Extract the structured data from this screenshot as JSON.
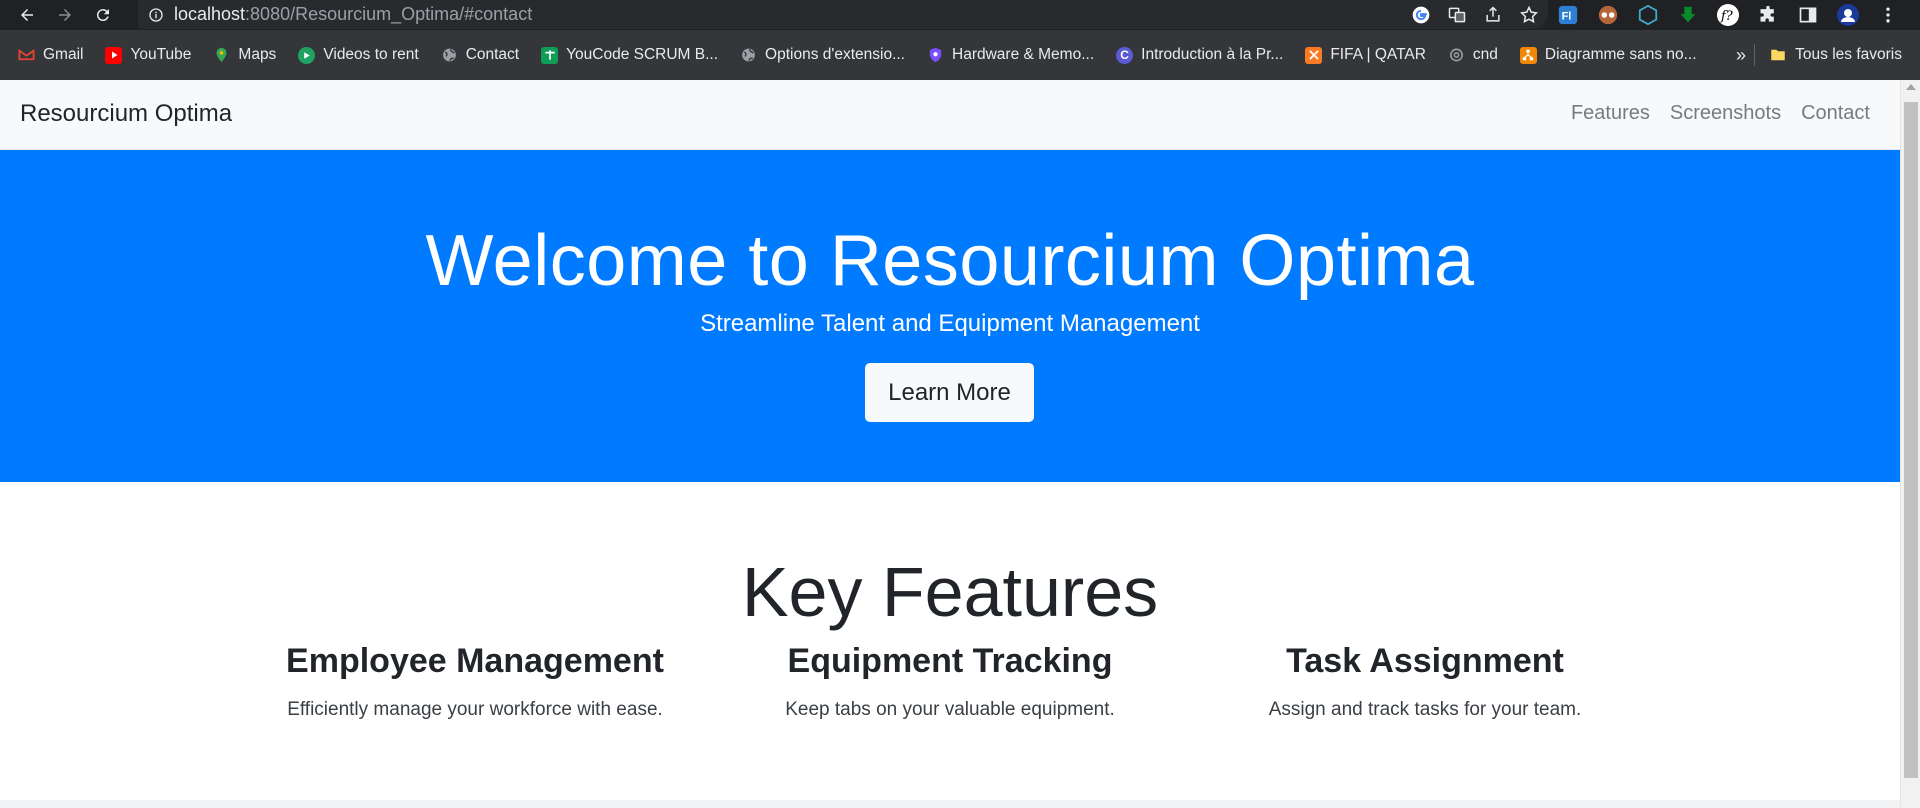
{
  "browser": {
    "url_host": "localhost",
    "url_rest": ":8080/Resourcium_Optima/#contact",
    "bookmarks": [
      {
        "label": "Gmail",
        "icon": "gmail-icon",
        "color": "#ea4335"
      },
      {
        "label": "YouTube",
        "icon": "youtube-icon",
        "color": "#ff0000"
      },
      {
        "label": "Maps",
        "icon": "maps-icon",
        "color": "#34a853"
      },
      {
        "label": "Videos to rent",
        "icon": "video-icon",
        "color": "#1ea362"
      },
      {
        "label": "Contact",
        "icon": "globe-icon",
        "color": "#9aa0a6"
      },
      {
        "label": "YouCode SCRUM B...",
        "icon": "sheets-icon",
        "color": "#0f9d58"
      },
      {
        "label": "Options d'extensio...",
        "icon": "globe-icon",
        "color": "#9aa0a6"
      },
      {
        "label": "Hardware & Memo...",
        "icon": "shield-icon",
        "color": "#7c4dff"
      },
      {
        "label": "Introduction à la Pr...",
        "icon": "c-icon",
        "color": "#5b5bd6"
      },
      {
        "label": "FIFA | QATAR",
        "icon": "xampp-icon",
        "color": "#fb7a24"
      },
      {
        "label": "cnd",
        "icon": "chatgpt-icon",
        "color": "#9aa0a6"
      },
      {
        "label": "Diagramme sans no...",
        "icon": "drawio-icon",
        "color": "#f08705"
      }
    ],
    "more_label": "»",
    "all_bookmarks_label": "Tous les favoris"
  },
  "site": {
    "brand": "Resourcium Optima",
    "nav": [
      "Features",
      "Screenshots",
      "Contact"
    ],
    "hero": {
      "title": "Welcome to Resourcium Optima",
      "subtitle": "Streamline Talent and Equipment Management",
      "cta": "Learn More"
    },
    "features": {
      "heading": "Key Features",
      "items": [
        {
          "title": "Employee Management",
          "text": "Efficiently manage your workforce with ease."
        },
        {
          "title": "Equipment Tracking",
          "text": "Keep tabs on your valuable equipment."
        },
        {
          "title": "Task Assignment",
          "text": "Assign and track tasks for your team."
        }
      ]
    }
  },
  "colors": {
    "hero_bg": "#007bff",
    "navbar_bg": "#f8f9fa",
    "chrome_bg": "#202124",
    "bookmarks_bg": "#35363a"
  }
}
